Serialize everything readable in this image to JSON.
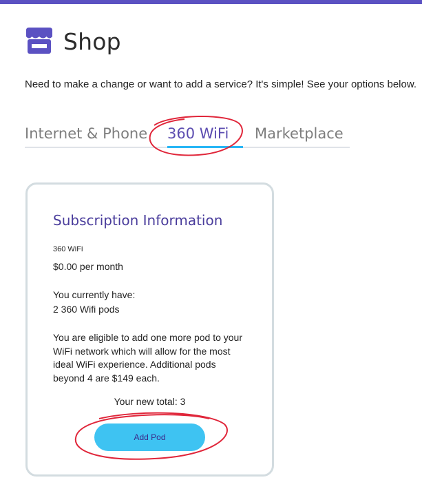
{
  "header": {
    "title": "Shop",
    "icon": "storefront-icon"
  },
  "intro": "Need to make a change or want to add a service? It's simple! See your options below.",
  "tabs": [
    {
      "label": "Internet & Phone",
      "active": false
    },
    {
      "label": "360 WiFi",
      "active": true
    },
    {
      "label": "Marketplace",
      "active": false
    }
  ],
  "card": {
    "title": "Subscription Information",
    "service_name": "360 WiFi",
    "price": "$0.00 per month",
    "have_label": "You currently have:",
    "have_value": "2 360 Wifi pods",
    "eligible_text": "You are eligible to add one more pod to your WiFi network which will allow for the most ideal WiFi experience. Additional pods beyond 4 are $149 each.",
    "new_total": "Your new total: 3",
    "add_button": "Add Pod"
  },
  "colors": {
    "accent": "#5b51c2",
    "active_tab": "#5b4cb0",
    "tab_underline": "#29b6f6",
    "button": "#3ec3f2",
    "annotation": "#e0263a"
  }
}
